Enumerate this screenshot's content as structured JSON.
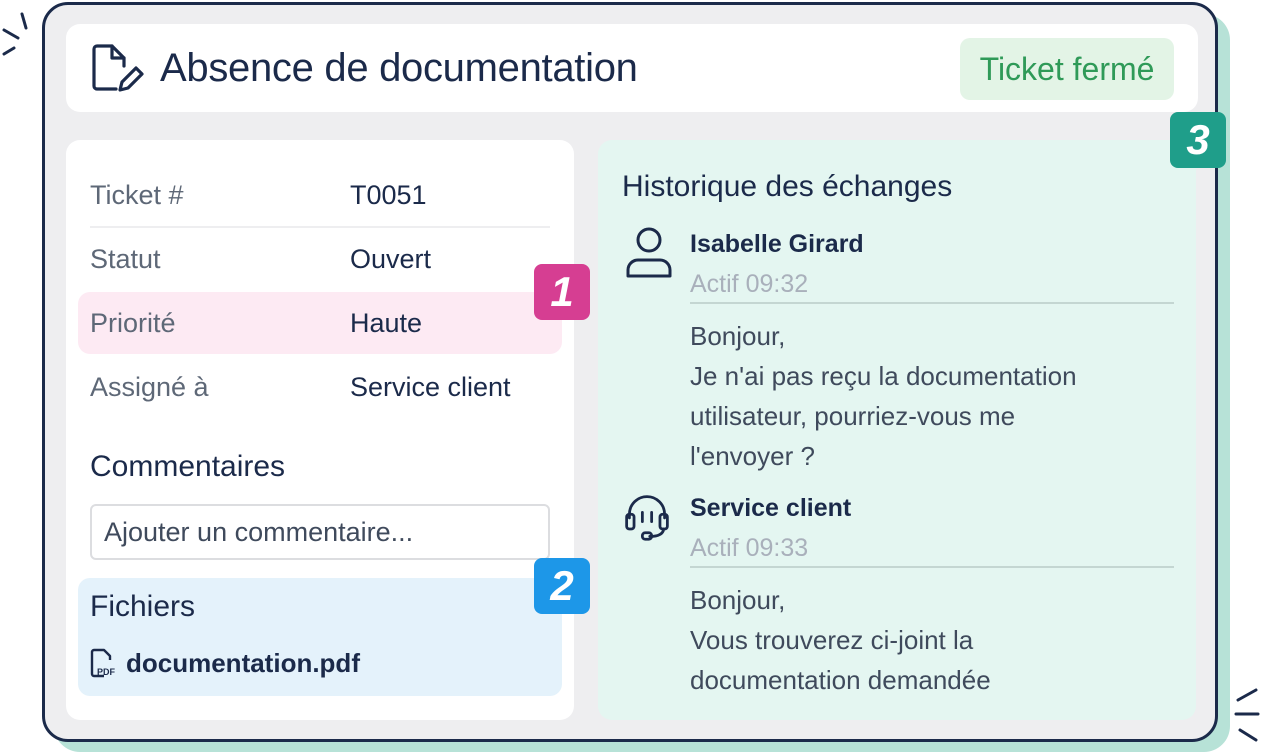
{
  "header": {
    "title": "Absence de documentation",
    "status_badge": "Ticket fermé"
  },
  "ticket_details": {
    "rows": [
      {
        "label": "Ticket #",
        "value": "T0051"
      },
      {
        "label": "Statut",
        "value": "Ouvert"
      },
      {
        "label": "Priorité",
        "value": "Haute"
      },
      {
        "label": "Assigné à",
        "value": "Service client"
      }
    ]
  },
  "comments": {
    "title": "Commentaires",
    "placeholder": "Ajouter un commentaire..."
  },
  "files": {
    "title": "Fichiers",
    "items": [
      {
        "name": "documentation.pdf",
        "icon": "pdf-file-icon",
        "icon_text": "PDF"
      }
    ]
  },
  "history": {
    "title": "Historique des échanges",
    "messages": [
      {
        "author": "Isabelle Girard",
        "time": "Actif 09:32",
        "icon": "user-icon",
        "lines": [
          "Bonjour,",
          "Je n'ai pas reçu la documentation",
          "utilisateur, pourriez-vous me",
          "l'envoyer ?"
        ]
      },
      {
        "author": "Service client",
        "time": "Actif 09:33",
        "icon": "headset-icon",
        "lines": [
          "Bonjour,",
          "Vous trouverez ci-joint la",
          "documentation demandée"
        ]
      }
    ]
  },
  "markers": [
    "1",
    "2",
    "3"
  ],
  "colors": {
    "navy": "#1b2a4a",
    "marker_1": "#d63e92",
    "marker_2": "#1d97e8",
    "marker_3": "#1f9e8a",
    "priority_highlight": "#fdeaf3",
    "files_background": "#e4f2fb",
    "history_background": "#e4f6f1",
    "badge_background": "#e3f4e6",
    "badge_text": "#2f9a58"
  }
}
